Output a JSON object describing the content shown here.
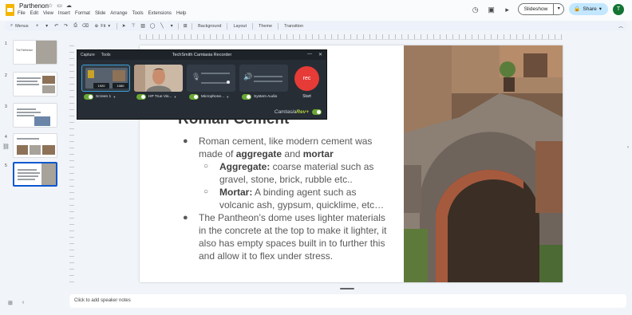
{
  "document": {
    "title": "Parthenon"
  },
  "menu": [
    "File",
    "Edit",
    "View",
    "Insert",
    "Format",
    "Slide",
    "Arrange",
    "Tools",
    "Extensions",
    "Help"
  ],
  "header_buttons": {
    "slideshow": "Slideshow",
    "share": "Share",
    "avatar_initial": "T"
  },
  "toolbar": {
    "menus_label": "Menus",
    "zoom": "Fit",
    "background": "Background",
    "layout": "Layout",
    "theme": "Theme",
    "transition": "Transition"
  },
  "filmstrip": {
    "slides": [
      {
        "number": "1",
        "caption": "The Parthenon"
      },
      {
        "number": "2"
      },
      {
        "number": "3"
      },
      {
        "number": "4"
      },
      {
        "number": "5",
        "selected": true
      }
    ]
  },
  "slide": {
    "heading": "Roman Cement",
    "bullet1_pre": "Roman cement, like modern cement was made of ",
    "bullet1_bold1": "aggregate",
    "bullet1_mid": " and ",
    "bullet1_bold2": "mortar",
    "sub1_bold": "Aggregate:",
    "sub1_text": " coarse material such as gravel, stone, brick, rubble etc..",
    "sub2_bold": "Mortar:",
    "sub2_text": " A binding agent such as volcanic ash,  gypsum, quicklime, etc…",
    "bullet2": "The Pantheon’s dome uses lighter materials in the concrete at the top to make it lighter, it also has empty spaces built in to further this and allow it to flex under stress."
  },
  "notes": {
    "placeholder": "Click to add speaker notes"
  },
  "recorder": {
    "menu_capture": "Capture",
    "menu_tools": "Tools",
    "title": "TechSmith Camtasia Recorder",
    "res_w": "1920",
    "res_h": "1080",
    "screen_label": "Screen 1",
    "camera_label": "HP True Vis...",
    "mic_label": "Microphone...",
    "audio_label": "System Audio",
    "rec_label": "rec",
    "start_label": "Start",
    "brand": "Camtasia",
    "brand_accent": "Rev",
    "brand_mark": "+"
  },
  "colors": {
    "accent": "#0b57d0",
    "rec": "#e63b36",
    "toggle_on": "#6aa833"
  }
}
